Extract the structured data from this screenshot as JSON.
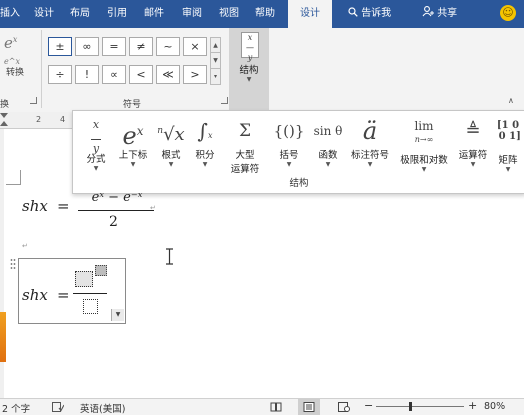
{
  "tabs": [
    {
      "id": "insert",
      "label": "插入"
    },
    {
      "id": "design",
      "label": "设计"
    },
    {
      "id": "layout",
      "label": "布局"
    },
    {
      "id": "references",
      "label": "引用"
    },
    {
      "id": "mailings",
      "label": "邮件"
    },
    {
      "id": "review",
      "label": "审阅"
    },
    {
      "id": "view",
      "label": "视图"
    },
    {
      "id": "help",
      "label": "帮助"
    },
    {
      "id": "eq-design",
      "label": "设计"
    }
  ],
  "tellme": "告诉我",
  "share": "共享",
  "ribbon": {
    "convert_label": "转换",
    "convert_group_label": "换",
    "symbols_group_label": "符号",
    "symbols_row1": [
      "±",
      "∞",
      "=",
      "≠",
      "~",
      "×"
    ],
    "symbols_row2": [
      "÷",
      "!",
      "∝",
      "<",
      "≪",
      ">"
    ],
    "structure_button_label": "结构"
  },
  "structures": {
    "group_label": "结构",
    "items": [
      {
        "label": "分式",
        "glyph": "x/y"
      },
      {
        "label": "上下标",
        "glyph": "eˣ"
      },
      {
        "label": "根式",
        "glyph": "ⁿ√x"
      },
      {
        "label": "积分",
        "glyph": "∫"
      },
      {
        "label": "大型运算符",
        "label_line1": "大型",
        "label_line2": "运算符",
        "glyph": "Σ"
      },
      {
        "label": "括号",
        "glyph": "{()}"
      },
      {
        "label": "函数",
        "glyph": "sinθ"
      },
      {
        "label": "标注符号",
        "glyph": "ä"
      },
      {
        "label": "极限和对数",
        "glyph": "lim n→∞"
      },
      {
        "label": "运算符",
        "glyph": "≜"
      },
      {
        "label": "矩阵",
        "glyph": "[10;01]"
      }
    ]
  },
  "ruler": {
    "ticks": [
      "2",
      "4"
    ]
  },
  "document": {
    "eq1": {
      "lhs": "shx",
      "equals": "=",
      "numerator": "eˣ − e⁻ˣ",
      "denominator": "2"
    },
    "eq2": {
      "lhs": "shx",
      "equals": "="
    }
  },
  "status": {
    "word_count": "2 个字",
    "language": "英语(美国)",
    "zoom": "80%",
    "zoom_level": 0.8
  }
}
